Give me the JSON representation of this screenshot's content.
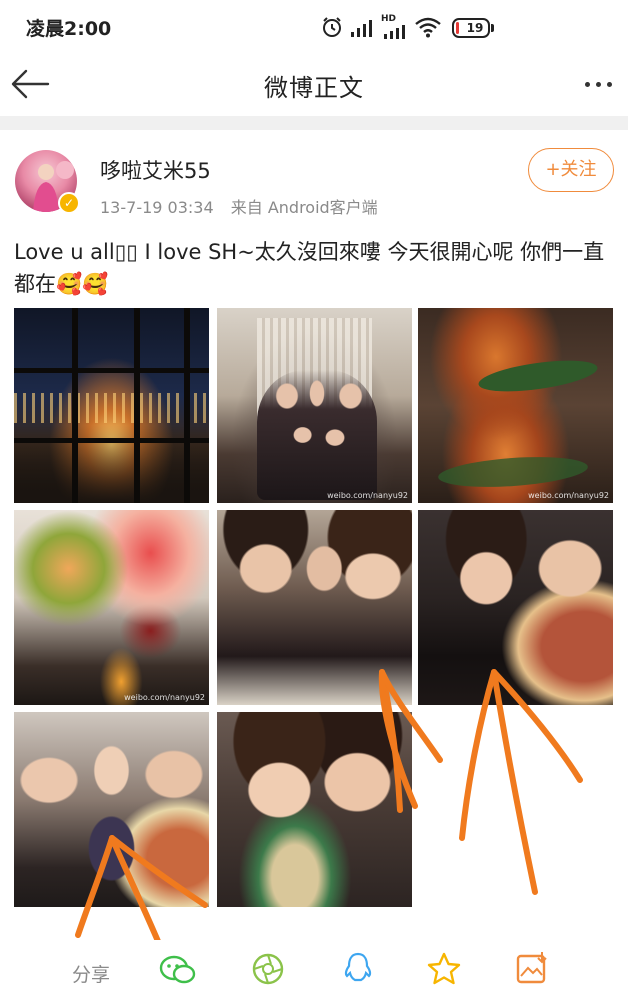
{
  "status_bar": {
    "time": "凌晨2:00",
    "network_label": "HD",
    "battery_level": "19"
  },
  "nav": {
    "title": "微博正文"
  },
  "post": {
    "username": "哆啦艾米55",
    "timestamp": "13-7-19 03:34",
    "source": "来自 Android客户端",
    "follow_label": "+关注",
    "text": "Love u all▯▯ I love SH~太久沒回來嘍 今天很開心呢 你們一直都在🥰🥰",
    "photos": [
      {
        "id": "photo-1",
        "watermark": ""
      },
      {
        "id": "photo-2",
        "watermark": "weibo.com/nanyu92"
      },
      {
        "id": "photo-3",
        "watermark": "weibo.com/nanyu92"
      },
      {
        "id": "photo-4",
        "watermark": "weibo.com/nanyu92"
      },
      {
        "id": "photo-5",
        "watermark": ""
      },
      {
        "id": "photo-6",
        "watermark": ""
      },
      {
        "id": "photo-7",
        "watermark": ""
      },
      {
        "id": "photo-8",
        "watermark": ""
      }
    ]
  },
  "toolbar": {
    "share_label": "分享"
  },
  "colors": {
    "accent": "#f08b3c",
    "verified": "#f7b500",
    "annotation": "#f07a1e",
    "muted_text": "#8a8a8a"
  },
  "icons": {
    "back": "back-arrow-icon",
    "more": "more-dots-icon",
    "wechat": "wechat-icon",
    "moments": "moments-icon",
    "qq": "qq-icon",
    "favorite": "star-icon",
    "save_image": "save-image-icon"
  }
}
